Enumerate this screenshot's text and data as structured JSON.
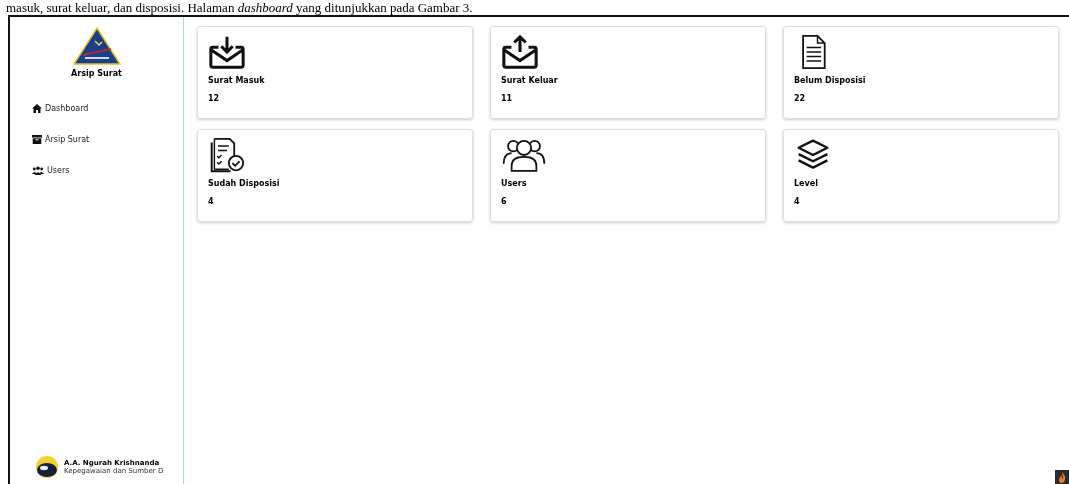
{
  "document_text": "masuk, surat keluar, dan disposisi. Halaman *dashboard* yang ditunjukkan pada Gambar 3.",
  "sidebar": {
    "app_name": "Arsip Surat",
    "items": [
      {
        "label": "Dashboard",
        "kind": "home"
      },
      {
        "label": "Arsip Surat",
        "kind": "archive"
      },
      {
        "label": "Users",
        "kind": "users"
      }
    ],
    "user": {
      "name": "A.A. Ngurah Krishnanda",
      "role": "Kepegawaian dan Sumber D"
    }
  },
  "cards": [
    {
      "title": "Surat Masuk",
      "count": "12",
      "kind": "inbox"
    },
    {
      "title": "Surat Keluar",
      "count": "11",
      "kind": "outbox"
    },
    {
      "title": "Belum Disposisi",
      "count": "22",
      "kind": "document"
    },
    {
      "title": "Sudah Disposisi",
      "count": "4",
      "kind": "checklist"
    },
    {
      "title": "Users",
      "count": "6",
      "kind": "users"
    },
    {
      "title": "Level",
      "count": "4",
      "kind": "layers"
    }
  ]
}
